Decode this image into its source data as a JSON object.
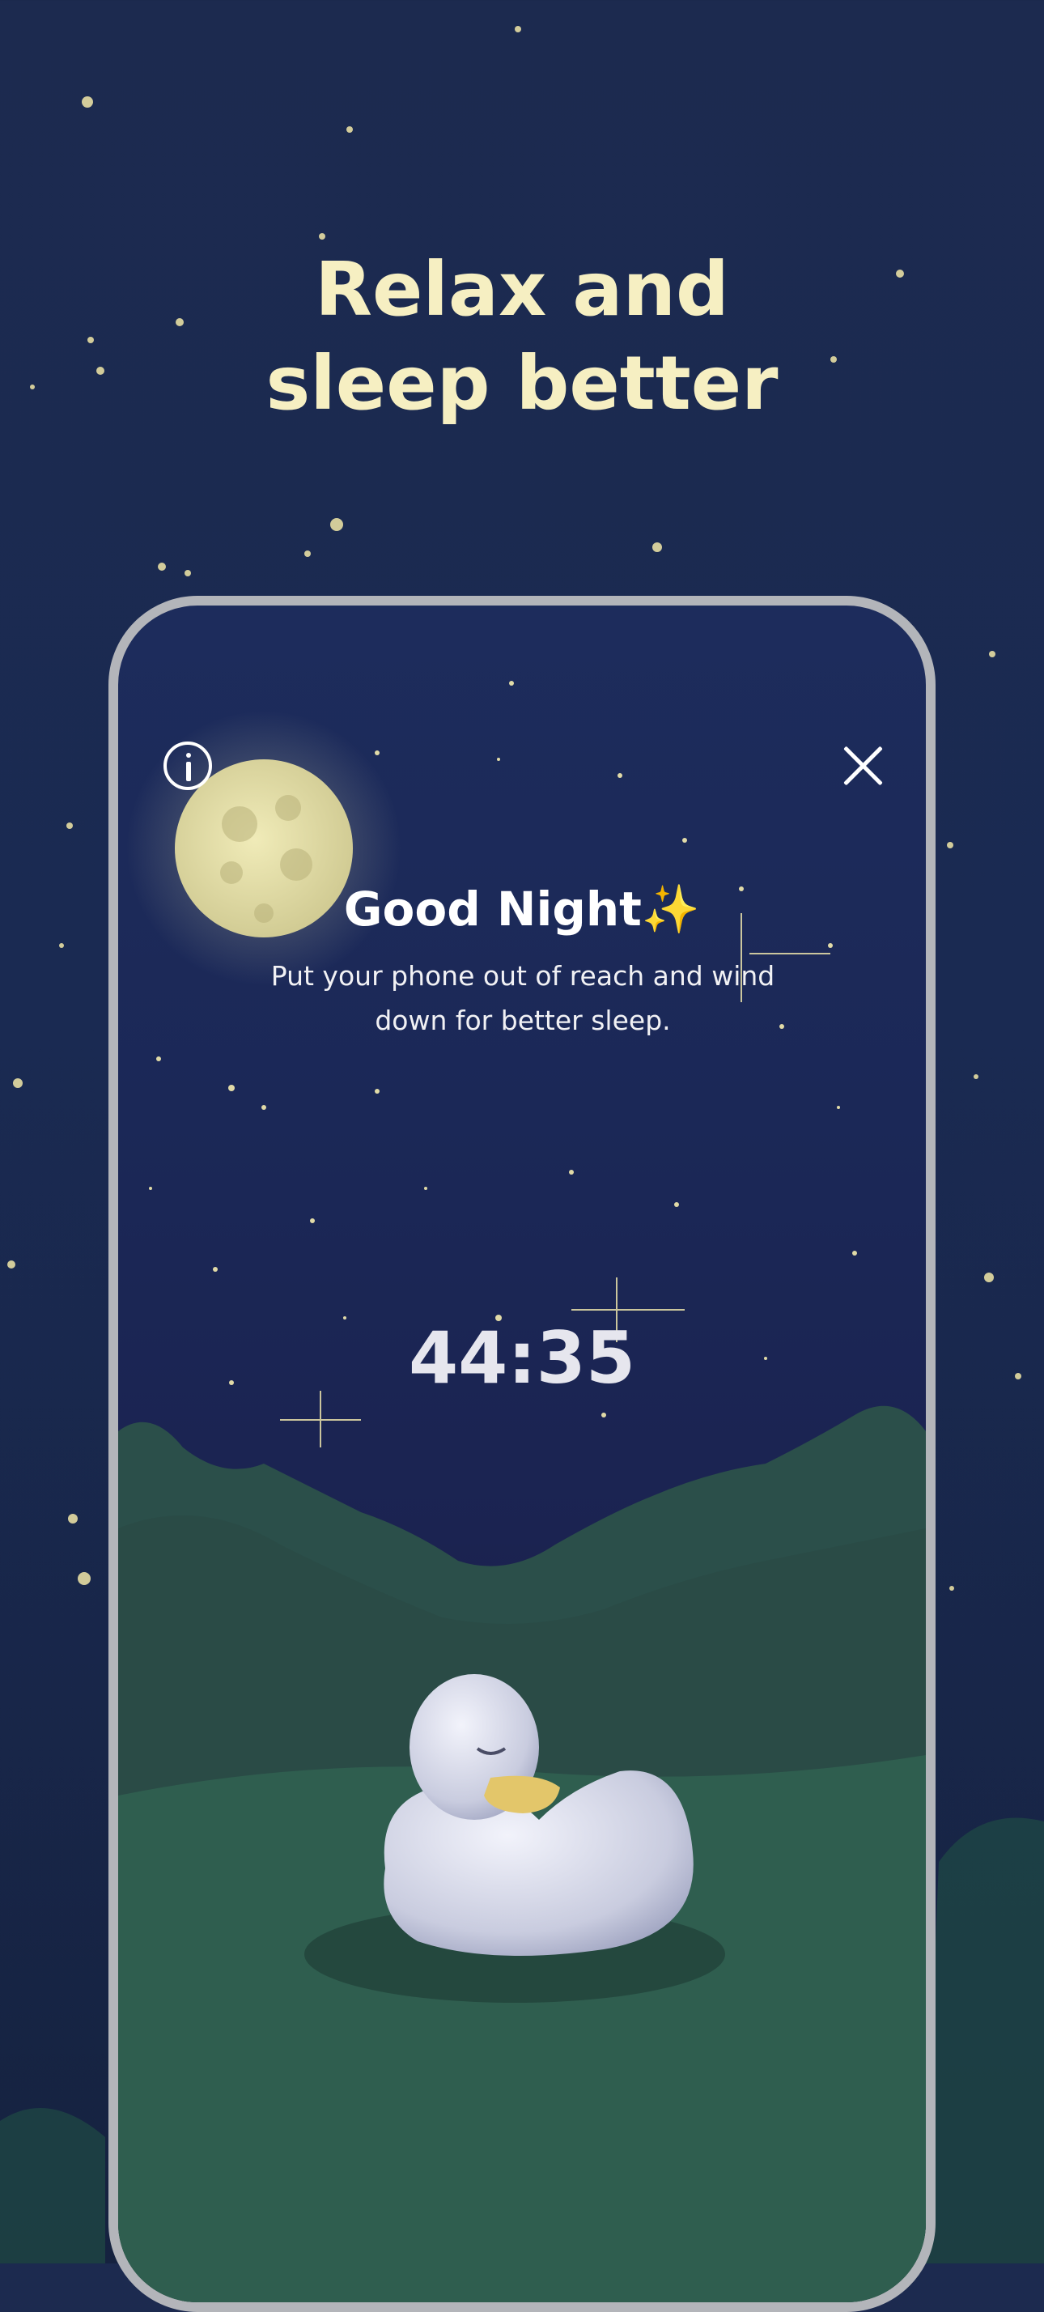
{
  "headline": {
    "line1": "Relax and",
    "line2": "sleep better"
  },
  "screen": {
    "info_icon": "info-icon",
    "close_icon": "close-icon",
    "title": "Good Night",
    "title_emoji": "✨",
    "subtitle": "Put your phone out of reach and wind down for better sleep.",
    "timer": "44:35"
  },
  "colors": {
    "headline": "#f6efc2",
    "background": "#1b2a50",
    "phone_frame": "#b3b5ba",
    "grass": "#2b5b4a",
    "moon": "#e8e3a8"
  }
}
